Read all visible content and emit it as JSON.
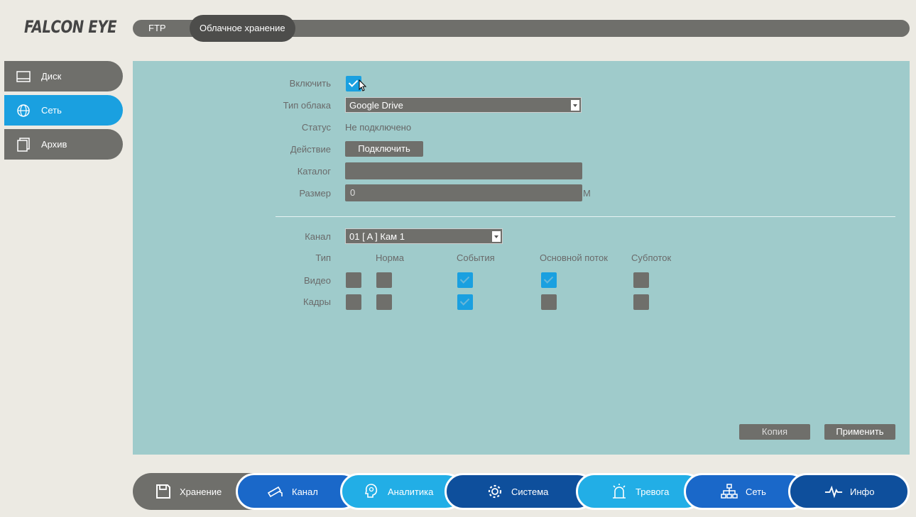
{
  "logo": "FALCON EYE",
  "tabs": {
    "ftp": "FTP",
    "cloud": "Облачное хранение"
  },
  "sidebar": [
    {
      "label": "Диск",
      "icon": "disk-icon"
    },
    {
      "label": "Сеть",
      "icon": "globe-icon"
    },
    {
      "label": "Архив",
      "icon": "archive-icon"
    }
  ],
  "form": {
    "enable_label": "Включить",
    "enable_checked": true,
    "cloud_type_label": "Тип облака",
    "cloud_type_value": "Google Drive",
    "status_label": "Статус",
    "status_value": "Не подключено",
    "action_label": "Действие",
    "connect_button": "Подключить",
    "catalog_label": "Каталог",
    "catalog_value": "",
    "size_label": "Размер",
    "size_value": "0",
    "size_unit": "M"
  },
  "channel": {
    "channel_label": "Канал",
    "channel_value": "01 [ A ] Кам 1",
    "type_label": "Тип",
    "col_normal": "Норма",
    "col_events": "События",
    "col_main": "Основной поток",
    "col_sub": "Субпоток",
    "video_label": "Видео",
    "frames_label": "Кадры",
    "video": {
      "all": false,
      "normal": false,
      "events": true,
      "main": true,
      "sub": false
    },
    "frames": {
      "all": false,
      "normal": false,
      "events": true,
      "main": false,
      "sub": false
    }
  },
  "buttons": {
    "copy": "Копия",
    "apply": "Применить"
  },
  "bottom_nav": [
    {
      "label": "Хранение",
      "icon": "save-icon",
      "color": "#6f6f6b"
    },
    {
      "label": "Канал",
      "icon": "camera-icon",
      "color": "#1a68c9"
    },
    {
      "label": "Аналитика",
      "icon": "analytics-icon",
      "color": "#22aee6"
    },
    {
      "label": "Система",
      "icon": "gear-icon",
      "color": "#0e4f9c"
    },
    {
      "label": "Тревога",
      "icon": "alarm-icon",
      "color": "#22aee6"
    },
    {
      "label": "Сеть",
      "icon": "network-icon",
      "color": "#1a68c9"
    },
    {
      "label": "Инфо",
      "icon": "pulse-icon",
      "color": "#0e4f9c"
    }
  ]
}
